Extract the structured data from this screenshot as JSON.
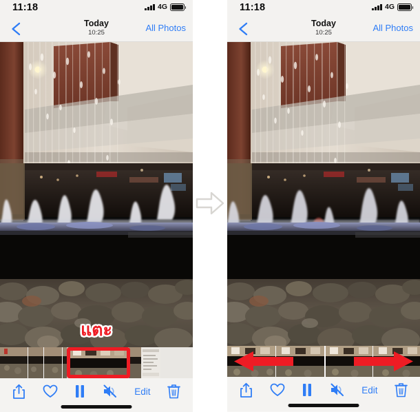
{
  "meta": {
    "app": "Photos",
    "platform": "iOS",
    "panel_count": 2,
    "accent_blue": "#2f7df6",
    "annotation_red": "#ee1c24",
    "bg": "#ffffff",
    "chrome_bg": "#f3f2f0",
    "strip_bg": "#cfccc6"
  },
  "panels": [
    {
      "id": "before",
      "status_bar": {
        "time": "11:18",
        "signal_icon": "cellular-bars-icon",
        "network_label": "4G",
        "battery_icon": "battery-icon"
      },
      "nav_bar": {
        "back_icon": "chevron-left-icon",
        "title": "Today",
        "subtitle": "10:25",
        "right_action": "All Photos"
      },
      "photo": {
        "alt_name": "mall-fountain-photo",
        "description": "Indoor shopping mall water curtain fountain over river rocks"
      },
      "annotation": {
        "text": "แตะ",
        "meaning": "tap",
        "color": "#ee1c24",
        "outline": "#ffffff",
        "highlight_box_color": "#ee1c24"
      },
      "filmstrip": {
        "thumb_count": 7,
        "selected_index": 4,
        "selected_highlighted": true
      },
      "toolbar": {
        "items": [
          {
            "name": "share-icon",
            "label": ""
          },
          {
            "name": "heart-icon",
            "label": ""
          },
          {
            "name": "pause-icon",
            "label": ""
          },
          {
            "name": "speaker-mute-icon",
            "label": ""
          },
          {
            "name": "edit-button",
            "label": "Edit"
          },
          {
            "name": "trash-icon",
            "label": ""
          }
        ]
      },
      "home_indicator": true
    },
    {
      "id": "after",
      "status_bar": {
        "time": "11:18",
        "signal_icon": "cellular-bars-icon",
        "network_label": "4G",
        "battery_icon": "battery-icon"
      },
      "nav_bar": {
        "back_icon": "chevron-left-icon",
        "title": "Today",
        "subtitle": "10:25",
        "right_action": "All Photos"
      },
      "photo": {
        "alt_name": "mall-fountain-photo",
        "description": "Indoor shopping mall water curtain fountain over river rocks"
      },
      "annotation": {
        "arrow_left": "red-arrow-left",
        "arrow_right": "red-arrow-right",
        "color": "#ee1c24",
        "meaning": "drag trim handles left or right"
      },
      "filmstrip": {
        "expanded": true,
        "thumb_count": 4
      },
      "toolbar": {
        "items": [
          {
            "name": "share-icon",
            "label": ""
          },
          {
            "name": "heart-icon",
            "label": ""
          },
          {
            "name": "pause-icon",
            "label": ""
          },
          {
            "name": "speaker-mute-icon",
            "label": ""
          },
          {
            "name": "edit-button",
            "label": "Edit"
          },
          {
            "name": "trash-icon",
            "label": ""
          }
        ]
      },
      "home_indicator": true
    }
  ],
  "step_arrow": {
    "name": "step-arrow-right",
    "color": "#d8d6d2"
  }
}
